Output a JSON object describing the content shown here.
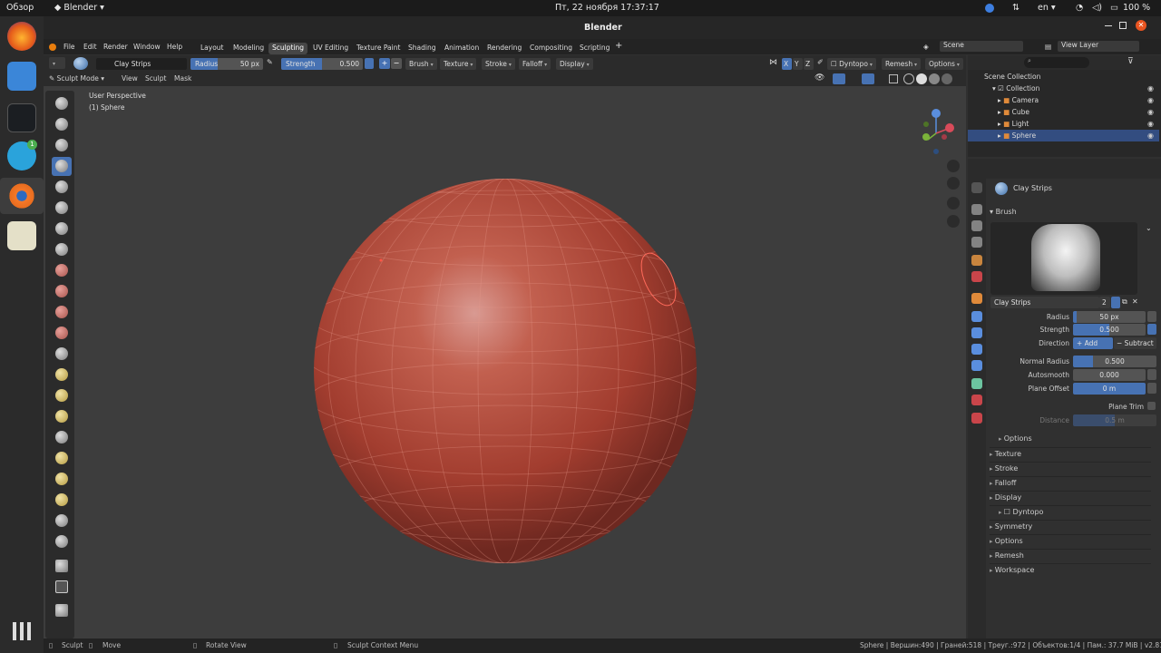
{
  "topbar": {
    "overview": "Обзор",
    "app": "Blender",
    "datetime": "Пт, 22 ноября  17:37:17",
    "lang": "en",
    "battery": "100 %"
  },
  "window": {
    "title": "Blender"
  },
  "menu": [
    "File",
    "Edit",
    "Render",
    "Window",
    "Help"
  ],
  "workspaces": [
    "Layout",
    "Modeling",
    "Sculpting",
    "UV Editing",
    "Texture Paint",
    "Shading",
    "Animation",
    "Rendering",
    "Compositing",
    "Scripting"
  ],
  "active_workspace": "Sculpting",
  "scene": {
    "scene_name": "Scene",
    "view_layer": "View Layer"
  },
  "tool_header": {
    "brush": "Clay Strips",
    "radius_label": "Radius",
    "radius": "50 px",
    "strength_label": "Strength",
    "strength": "0.500",
    "brush_menu": "Brush",
    "texture_menu": "Texture",
    "stroke_menu": "Stroke",
    "falloff_menu": "Falloff",
    "display_menu": "Display",
    "axes": [
      "X",
      "Y",
      "Z"
    ],
    "dyntopo": "Dyntopo",
    "remesh": "Remesh",
    "options": "Options"
  },
  "viewport_header": {
    "mode": "Sculpt Mode",
    "view": "View",
    "sculpt": "Sculpt",
    "mask": "Mask"
  },
  "viewport": {
    "perspective": "User Perspective",
    "object": "(1) Sphere"
  },
  "outliner": {
    "root": "Scene Collection",
    "collection": "Collection",
    "items": [
      "Camera",
      "Cube",
      "Light",
      "Sphere"
    ]
  },
  "properties": {
    "title": "Clay Strips",
    "brush_panel": "Brush",
    "brush_name": "Clay Strips",
    "users": "2",
    "fields": [
      {
        "label": "Radius",
        "value": "50 px"
      },
      {
        "label": "Strength",
        "value": "0.500"
      },
      {
        "label": "Normal Radius",
        "value": "0.500"
      },
      {
        "label": "Autosmooth",
        "value": "0.000"
      },
      {
        "label": "Plane Offset",
        "value": "0 m"
      },
      {
        "label": "Distance",
        "value": "0.5 m"
      }
    ],
    "direction_label": "Direction",
    "add": "Add",
    "subtract": "Subtract",
    "plane_trim": "Plane Trim",
    "options_sub": "Options",
    "sections": [
      "Texture",
      "Stroke",
      "Falloff",
      "Display",
      "Dyntopo",
      "Symmetry",
      "Options",
      "Remesh",
      "Workspace"
    ]
  },
  "statusbar": {
    "sculpt": "Sculpt",
    "move": "Move",
    "rotate": "Rotate View",
    "context": "Sculpt Context Menu",
    "stats": "Sphere | Вершин:490 | Граней:518 | Треуг.:972 | Объектов:1/4 | Пам.: 37.7 MiB | v2.81.16"
  },
  "colors": {
    "accent": "#4772b3",
    "sphere": "#b9473a",
    "header": "#232323",
    "panel": "#303030",
    "viewport_bg": "#3c3c3c"
  }
}
